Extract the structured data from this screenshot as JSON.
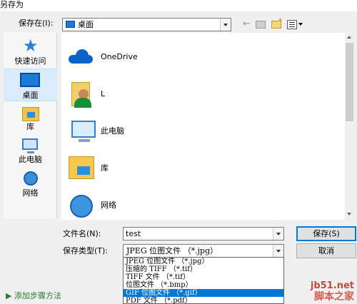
{
  "window": {
    "title": "另存为"
  },
  "toolbar": {
    "save_in_label": "保存在(I):",
    "save_in_value": "桌面",
    "icons": [
      "back-arrow-icon",
      "up-folder-icon",
      "new-folder-icon",
      "view-menu-icon"
    ]
  },
  "places": [
    {
      "label": "快速访问",
      "icon": "star-icon"
    },
    {
      "label": "桌面",
      "icon": "desktop-icon",
      "selected": true
    },
    {
      "label": "库",
      "icon": "library-icon"
    },
    {
      "label": "此电脑",
      "icon": "computer-icon"
    },
    {
      "label": "网络",
      "icon": "network-icon"
    }
  ],
  "files": [
    {
      "name": "OneDrive",
      "icon": "onedrive-cloud-icon"
    },
    {
      "name": "L",
      "icon": "user-folder-icon"
    },
    {
      "name": "此电脑",
      "icon": "computer-icon"
    },
    {
      "name": "库",
      "icon": "library-icon"
    },
    {
      "name": "网络",
      "icon": "network-icon"
    }
  ],
  "form": {
    "filename_label": "文件名(N):",
    "filename_value": "test",
    "filetype_label": "保存类型(T):",
    "filetype_value": "JPEG 位图文件 （*.jpg）"
  },
  "filetype_options": [
    "JPEG 位图文件 （*.jpg）",
    "压缩的 TIFF （*.tif）",
    "TIFF 文件 （*.tif）",
    "位图文件 （*.bmp）",
    "GIF 位图文件 （*.gif）",
    "PDF 文件 （*.pdf）"
  ],
  "highlighted_option_index": 4,
  "buttons": {
    "save": "保存(S)",
    "cancel": "取消"
  },
  "background": {
    "link_text": "▶ 添加步骤方法"
  },
  "watermark": {
    "line1": "jb51.net",
    "line2": "脚本之家"
  },
  "colors": {
    "selection": "#0078d7",
    "selected_place_bg": "#d9ecfb",
    "watermark": "#c0392b"
  }
}
